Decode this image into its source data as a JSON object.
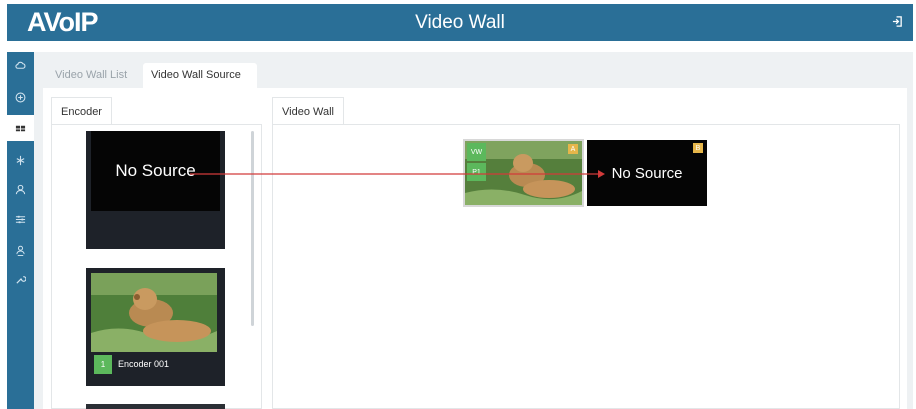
{
  "header": {
    "logo": "AVoIP",
    "title": "Video Wall",
    "logout_icon": "logout-icon"
  },
  "sidebar": {
    "items": [
      {
        "icon": "cloud-icon"
      },
      {
        "icon": "plus-circle-icon"
      },
      {
        "icon": "video-wall-grid-icon",
        "active": true
      },
      {
        "icon": "share-icon"
      },
      {
        "icon": "user-icon"
      },
      {
        "icon": "sliders-icon"
      },
      {
        "icon": "users-icon"
      },
      {
        "icon": "wrench-icon"
      }
    ]
  },
  "tabs": {
    "list": "Video Wall List",
    "source": "Video Wall Source"
  },
  "encoder_panel": {
    "tab": "Encoder",
    "cards": [
      {
        "label": "No Source",
        "type": "no-source"
      },
      {
        "number": "1",
        "label": "Encoder 001",
        "type": "lion"
      }
    ]
  },
  "wall_panel": {
    "tab": "Video Wall",
    "screens": [
      {
        "corner": "A",
        "badges": [
          "VW",
          "P1"
        ],
        "type": "lion"
      },
      {
        "corner": "B",
        "label": "No Source",
        "type": "no-source"
      }
    ]
  },
  "colors": {
    "accent": "#2a6f97",
    "badge": "#5cb85c",
    "corner": "#e6b64a",
    "drag_line": "#d23a3a"
  }
}
